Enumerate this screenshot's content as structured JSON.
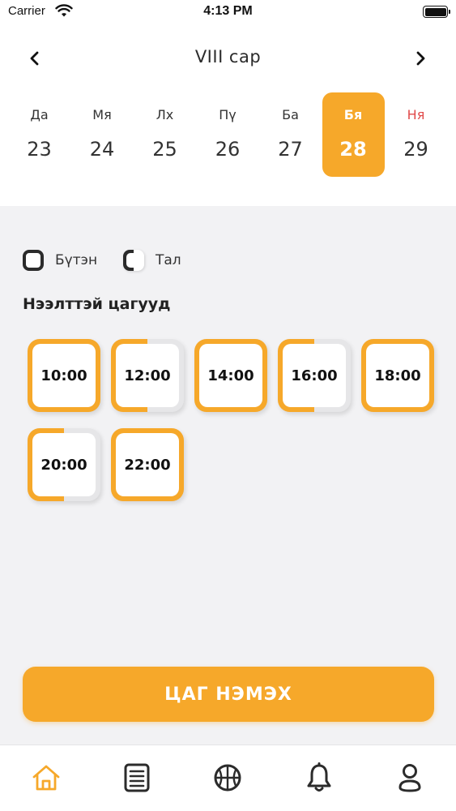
{
  "status_bar": {
    "carrier": "Carrier",
    "time": "4:13 PM"
  },
  "calendar": {
    "month": "VIII сар",
    "days": [
      {
        "name": "Да",
        "num": "23"
      },
      {
        "name": "Мя",
        "num": "24"
      },
      {
        "name": "Лх",
        "num": "25"
      },
      {
        "name": "Пү",
        "num": "26"
      },
      {
        "name": "Ба",
        "num": "27"
      },
      {
        "name": "Бя",
        "num": "28",
        "selected": true
      },
      {
        "name": "Ня",
        "num": "29",
        "sunday": true
      }
    ]
  },
  "legend": {
    "full_label": "Бүтэн",
    "half_label": "Тал"
  },
  "section_title": "Нээлттэй цагууд",
  "slots": [
    {
      "time": "10:00",
      "availability": "full"
    },
    {
      "time": "12:00",
      "availability": "half"
    },
    {
      "time": "14:00",
      "availability": "full"
    },
    {
      "time": "16:00",
      "availability": "half"
    },
    {
      "time": "18:00",
      "availability": "full"
    },
    {
      "time": "20:00",
      "availability": "half"
    },
    {
      "time": "22:00",
      "availability": "full"
    }
  ],
  "add_button": "ЦАГ НЭМЭХ",
  "tabs": [
    {
      "icon": "home-icon",
      "active": true
    },
    {
      "icon": "list-icon"
    },
    {
      "icon": "basketball-icon"
    },
    {
      "icon": "bell-icon"
    },
    {
      "icon": "profile-icon"
    }
  ],
  "colors": {
    "accent": "#f6a82a",
    "sunday": "#e14b4b",
    "dark": "#2b2b2b"
  }
}
